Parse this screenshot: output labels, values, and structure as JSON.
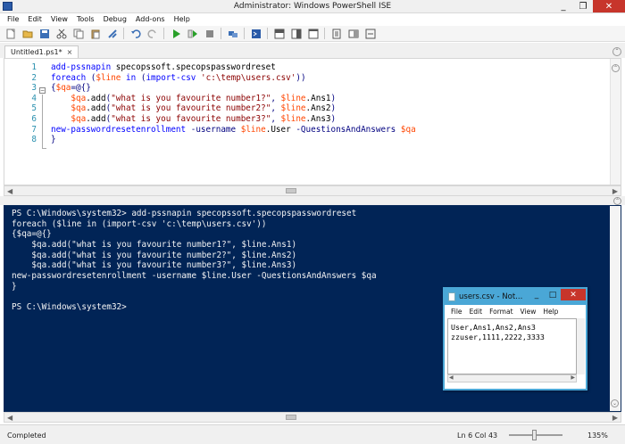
{
  "window": {
    "title": "Administrator: Windows PowerShell ISE"
  },
  "menu": [
    "File",
    "Edit",
    "View",
    "Tools",
    "Debug",
    "Add-ons",
    "Help"
  ],
  "toolbar": {
    "icons": [
      "new-file-icon",
      "open-icon",
      "save-icon",
      "cut-icon",
      "copy-icon",
      "paste-icon",
      "clear-icon",
      "undo-icon",
      "redo-icon",
      "run-icon",
      "run-selection-icon",
      "stop-icon",
      "remote-icon",
      "powershell-icon",
      "layout-top-icon",
      "layout-right-icon",
      "layout-max-icon",
      "show-commands-icon",
      "addons-icon",
      "expand-icon"
    ]
  },
  "tab": {
    "label": "Untitled1.ps1*",
    "close": "×"
  },
  "editor": {
    "line_numbers": [
      "1",
      "2",
      "3",
      "4",
      "5",
      "6",
      "7",
      "8"
    ],
    "lines": [
      "add-pssnapin specopssoft.specopspasswordreset",
      "foreach ($line in (import-csv 'c:\\temp\\users.csv'))",
      "{$qa=@{}",
      "    $qa.add(\"what is you favourite number1?\", $line.Ans1)",
      "    $qa.add(\"what is you favourite number2?\", $line.Ans2)",
      "    $qa.add(\"what is you favourite number3?\", $line.Ans3)",
      "new-passwordresetenrollment -username $line.User -QuestionsAndAnswers $qa",
      "}"
    ]
  },
  "console": {
    "lines": [
      "PS C:\\Windows\\system32> add-pssnapin specopssoft.specopspasswordreset",
      "foreach ($line in (import-csv 'c:\\temp\\users.csv'))",
      "{$qa=@{}",
      "    $qa.add(\"what is you favourite number1?\", $line.Ans1)",
      "    $qa.add(\"what is you favourite number2?\", $line.Ans2)",
      "    $qa.add(\"what is you favourite number3?\", $line.Ans3)",
      "new-passwordresetenrollment -username $line.User -QuestionsAndAnswers $qa",
      "}",
      "",
      "PS C:\\Windows\\system32>"
    ]
  },
  "status": {
    "text": "Completed",
    "position": "Ln 6  Col 43",
    "zoom": "135%"
  },
  "notepad": {
    "title": "users.csv - Not...",
    "menu": [
      "File",
      "Edit",
      "Format",
      "View",
      "Help"
    ],
    "lines": [
      "User,Ans1,Ans2,Ans3",
      "zzuser,1111,2222,3333"
    ]
  }
}
